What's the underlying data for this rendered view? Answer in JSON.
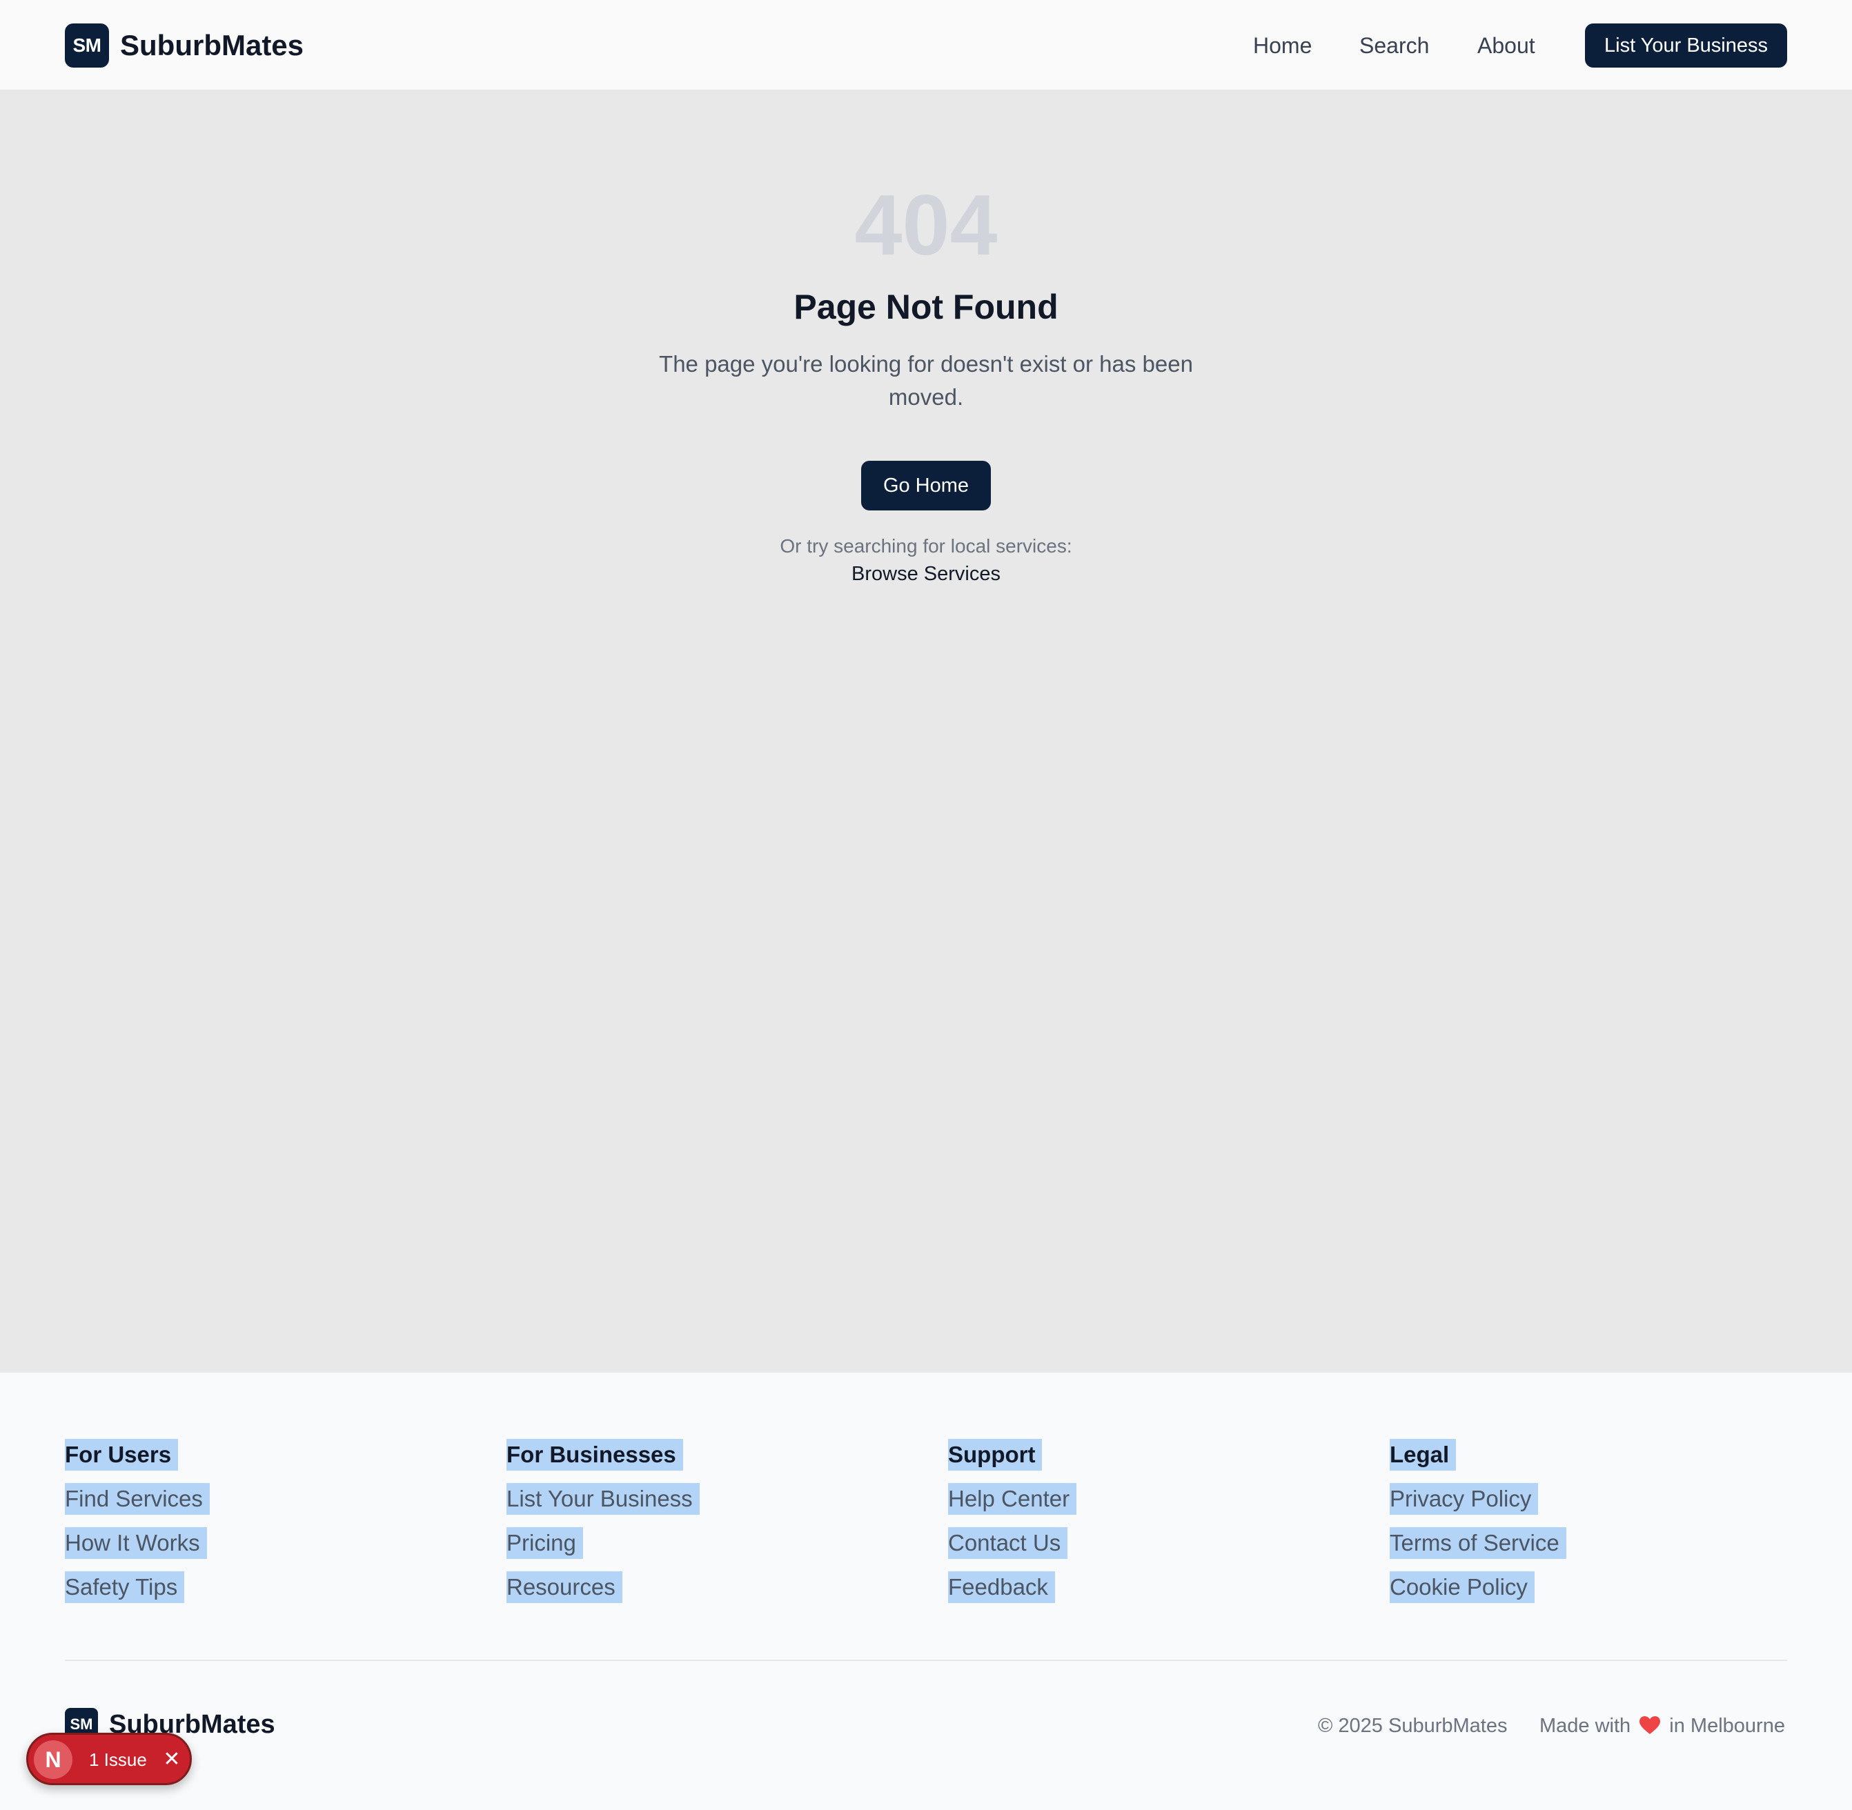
{
  "header": {
    "logo_badge": "SM",
    "brand": "SuburbMates",
    "nav": {
      "home": "Home",
      "search": "Search",
      "about": "About"
    },
    "cta": "List Your Business"
  },
  "main": {
    "code": "404",
    "title": "Page Not Found",
    "description": "The page you're looking for doesn't exist or has been moved.",
    "go_home": "Go Home",
    "hint": "Or try searching for local services:",
    "browse": "Browse Services"
  },
  "footer": {
    "columns": [
      {
        "heading": "For Users",
        "links": [
          "Find Services",
          "How It Works",
          "Safety Tips"
        ]
      },
      {
        "heading": "For Businesses",
        "links": [
          "List Your Business",
          "Pricing",
          "Resources"
        ]
      },
      {
        "heading": "Support",
        "links": [
          "Help Center",
          "Contact Us",
          "Feedback"
        ]
      },
      {
        "heading": "Legal",
        "links": [
          "Privacy Policy",
          "Terms of Service",
          "Cookie Policy"
        ]
      }
    ],
    "logo_badge": "SM",
    "brand": "SuburbMates",
    "copyright": "© 2025 SuburbMates",
    "made_with_prefix": "Made with",
    "made_with_suffix": "in Melbourne"
  },
  "dev_overlay": {
    "badge": "N",
    "issues": "1 Issue",
    "close": "✕"
  },
  "colors": {
    "brand_dark": "#0b1f3a",
    "heart": "#ef4444",
    "issue_red": "#c8212b",
    "selection": "#b3d4f7"
  },
  "icons": {
    "heart": "heart-icon",
    "close": "close-icon",
    "next_logo": "nextjs-icon"
  }
}
